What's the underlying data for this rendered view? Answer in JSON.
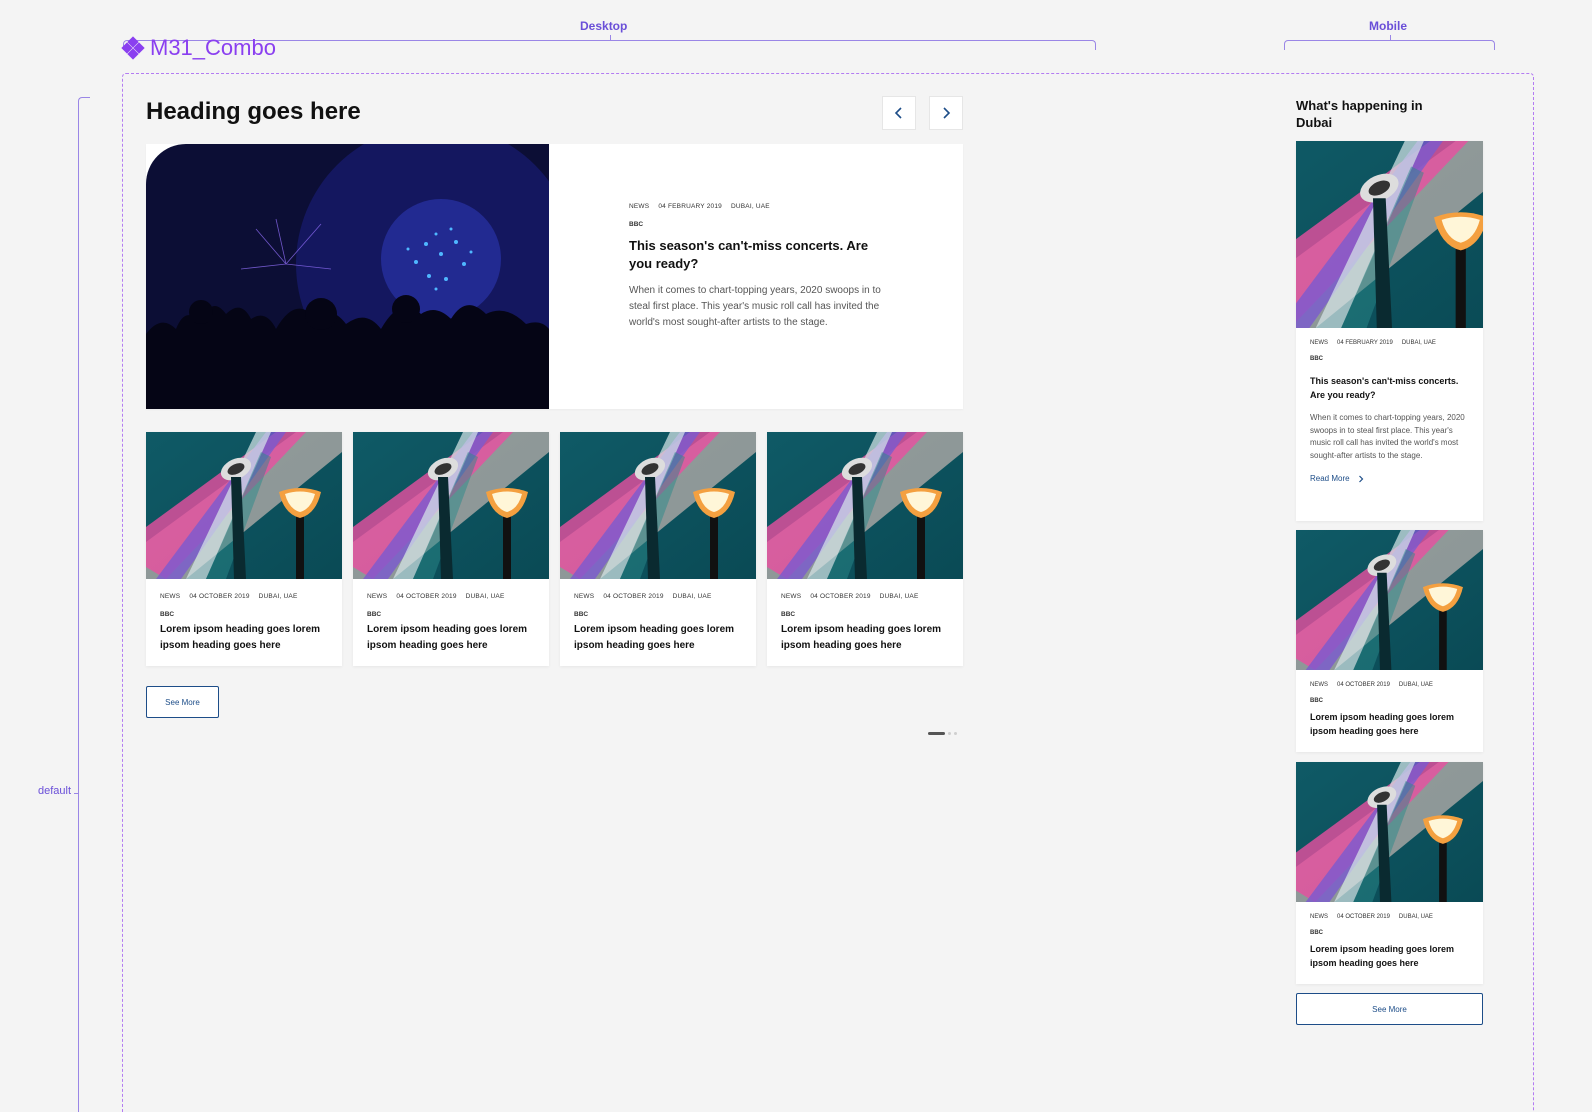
{
  "figma": {
    "desktop_label": "Desktop",
    "mobile_label": "Mobile",
    "component_name": "M31_Combo",
    "variant_label": "default"
  },
  "desktop": {
    "heading": "Heading goes here",
    "prev_icon": "chevron-left-icon",
    "next_icon": "chevron-right-icon",
    "featured": {
      "category": "NEWS",
      "date": "04 FEBRUARY 2019",
      "location": "DUBAI, UAE",
      "source": "BBC",
      "title": "This season's can't-miss concerts. Are you ready?",
      "description": "When it comes to chart-topping years, 2020 swoops in to steal first place. This year's music roll call has invited the world's most sought-after artists to the stage."
    },
    "cards": [
      {
        "category": "NEWS",
        "date": "04 OCTOBER 2019",
        "location": "DUBAI, UAE",
        "source": "BBC",
        "title": "Lorem ipsom heading goes lorem ipsom heading goes here"
      },
      {
        "category": "NEWS",
        "date": "04 OCTOBER 2019",
        "location": "DUBAI, UAE",
        "source": "BBC",
        "title": "Lorem ipsom heading goes lorem ipsom heading goes here"
      },
      {
        "category": "NEWS",
        "date": "04 OCTOBER 2019",
        "location": "DUBAI, UAE",
        "source": "BBC",
        "title": "Lorem ipsom heading goes lorem ipsom heading goes here"
      },
      {
        "category": "NEWS",
        "date": "04 OCTOBER 2019",
        "location": "DUBAI, UAE",
        "source": "BBC",
        "title": "Lorem ipsom heading goes lorem ipsom heading goes here"
      }
    ],
    "see_more": "See More"
  },
  "mobile": {
    "heading": "What's happening in Dubai",
    "featured": {
      "category": "NEWS",
      "date": "04 FEBRUARY 2019",
      "location": "DUBAI, UAE",
      "source": "BBC",
      "title": "This season's can't-miss concerts. Are you ready?",
      "description": "When it comes to chart-topping years, 2020 swoops in to steal first place. This year's music roll call has invited the world's most sought-after artists to the stage.",
      "read_more": "Read More"
    },
    "cards": [
      {
        "category": "NEWS",
        "date": "04 OCTOBER 2019",
        "location": "DUBAI, UAE",
        "source": "BBC",
        "title": "Lorem ipsom heading goes lorem ipsom heading goes here"
      },
      {
        "category": "NEWS",
        "date": "04 OCTOBER 2019",
        "location": "DUBAI, UAE",
        "source": "BBC",
        "title": "Lorem ipsom heading goes lorem ipsom heading goes here"
      }
    ],
    "see_more": "See More"
  },
  "colors": {
    "accent": "#1d4d88",
    "figma_purple": "#8a3ff0",
    "background": "#f4f4f4"
  }
}
